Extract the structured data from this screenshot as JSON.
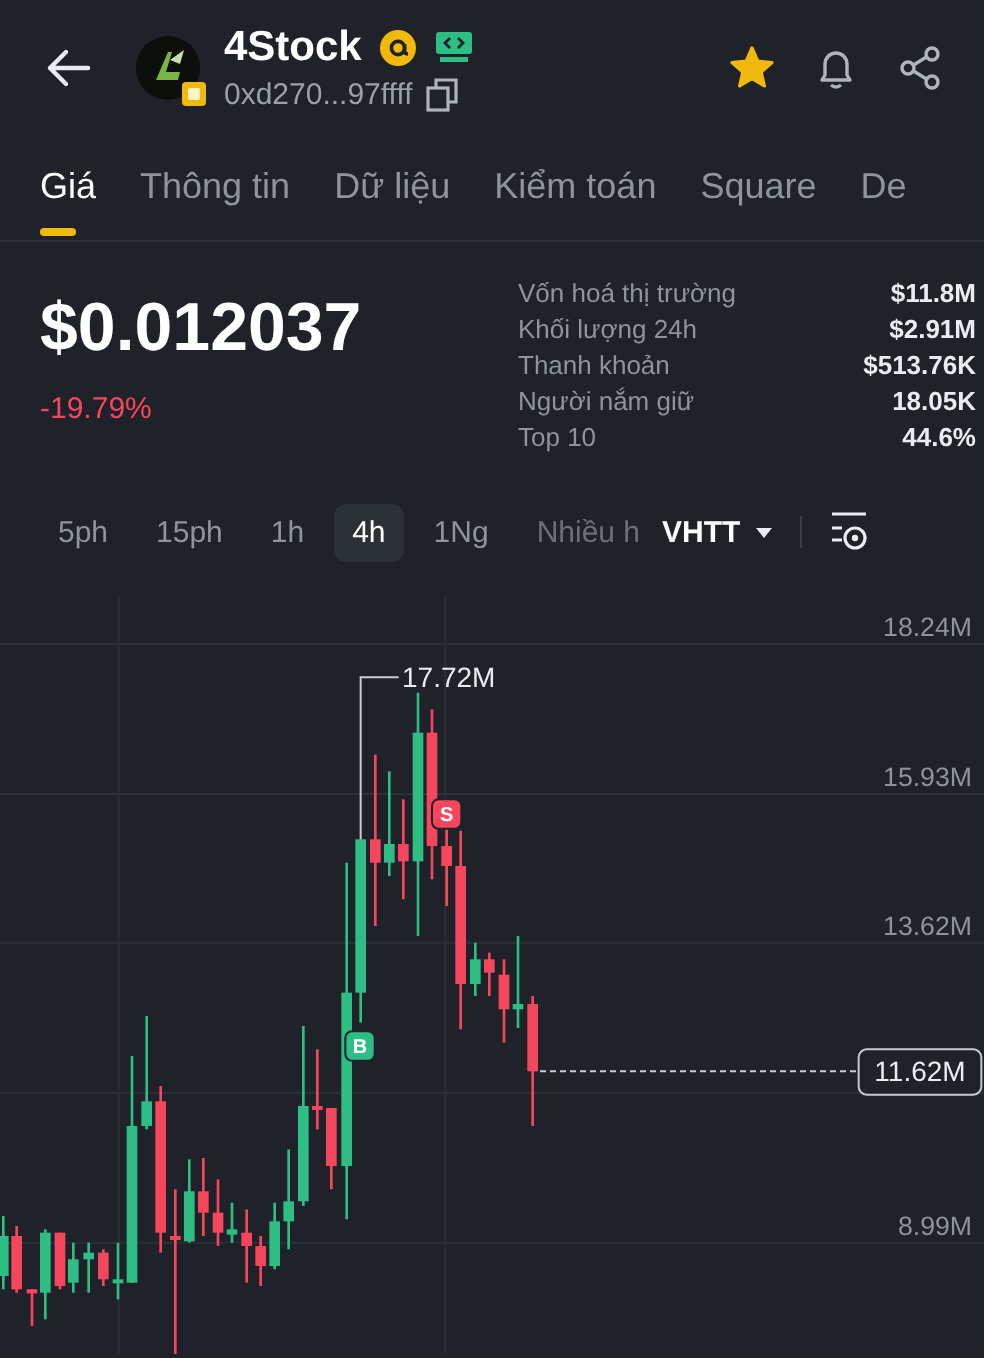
{
  "header": {
    "title": "4Stock",
    "address": "0xd270...97ffff",
    "favorite": true
  },
  "tabs": [
    {
      "label": "Giá",
      "selected": true
    },
    {
      "label": "Thông tin",
      "selected": false
    },
    {
      "label": "Dữ liệu",
      "selected": false
    },
    {
      "label": "Kiểm toán",
      "selected": false
    },
    {
      "label": "Square",
      "selected": false
    },
    {
      "label": "De",
      "selected": false
    }
  ],
  "price": {
    "value": "$0.012037",
    "change": "-19.79%"
  },
  "stats": [
    {
      "label": "Vốn hoá thị trường",
      "value": "$11.8M"
    },
    {
      "label": "Khối lượng 24h",
      "value": "$2.91M"
    },
    {
      "label": "Thanh khoản",
      "value": "$513.76K"
    },
    {
      "label": "Người nắm giữ",
      "value": "18.05K"
    },
    {
      "label": "Top 10",
      "value": "44.6%"
    }
  ],
  "intervals": [
    {
      "label": "5ph",
      "selected": false
    },
    {
      "label": "15ph",
      "selected": false
    },
    {
      "label": "1h",
      "selected": false
    },
    {
      "label": "4h",
      "selected": true
    },
    {
      "label": "1Ng",
      "selected": false
    },
    {
      "label": "Nhiều h",
      "selected": false
    }
  ],
  "chart_type": "VHTT",
  "chart": {
    "y_labels": [
      "18.24M",
      "15.93M",
      "13.62M",
      "8.99M"
    ],
    "high_label": "17.72M",
    "current_label": "11.62M",
    "markers": [
      {
        "kind": "buy",
        "label": "B"
      },
      {
        "kind": "sell",
        "label": "S"
      }
    ]
  }
}
